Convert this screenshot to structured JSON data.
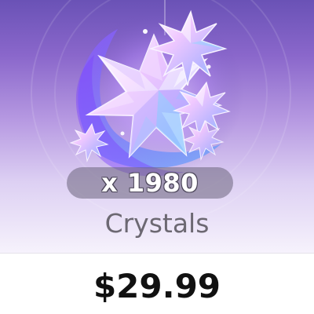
{
  "item": {
    "quantity_label": "x 1980",
    "name": "Crystals",
    "price": "$29.99",
    "icon": "crystal-cluster-icon"
  },
  "colors": {
    "banner_top": "#6a52b6",
    "banner_bottom": "#f6f2fc",
    "badge_bg": "#6c647c",
    "name_text": "#6c6872",
    "price_text": "#111111"
  }
}
